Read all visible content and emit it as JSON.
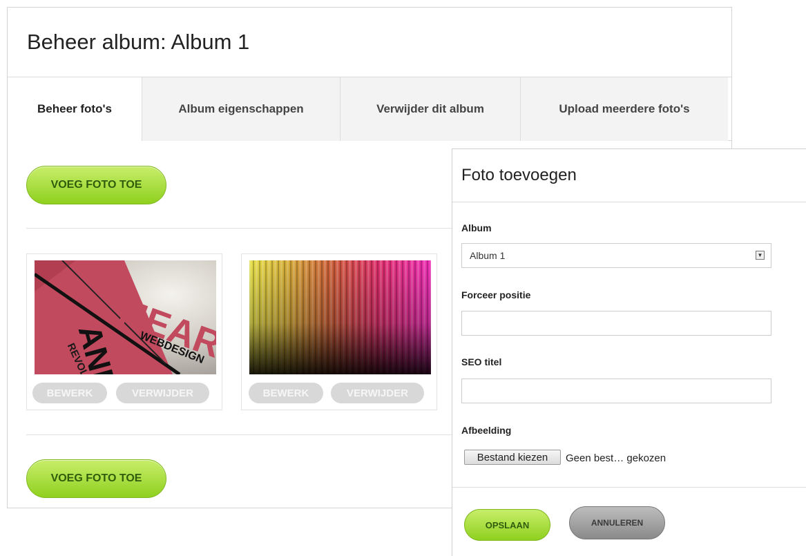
{
  "page": {
    "title": "Beheer album: Album 1"
  },
  "tabs": [
    {
      "label": "Beheer foto's",
      "active": true
    },
    {
      "label": "Album eigenschappen",
      "active": false
    },
    {
      "label": "Verwijder dit album",
      "active": false
    },
    {
      "label": "Upload meerdere foto's",
      "active": false
    }
  ],
  "actions": {
    "add_photo_label": "VOEG FOTO TOE"
  },
  "photos": [
    {
      "edit_label": "BEWERK",
      "delete_label": "VERWIJDER",
      "thumbnail_text": [
        "HEART",
        "AND",
        "WEBDESIGN",
        "REVOLUTION"
      ]
    },
    {
      "edit_label": "BEWERK",
      "delete_label": "VERWIJDER"
    }
  ],
  "dialog": {
    "title": "Foto toevoegen",
    "album_label": "Album",
    "album_value": "Album 1",
    "position_label": "Forceer positie",
    "position_value": "",
    "seo_label": "SEO titel",
    "seo_value": "",
    "image_label": "Afbeelding",
    "file_button": "Bestand kiezen",
    "file_status": "Geen best… gekozen",
    "save_label": "OPSLAAN",
    "cancel_label": "ANNULEREN"
  },
  "colors": {
    "accent_green": "#9ad62a",
    "button_text_green": "#2f5d0c",
    "pill_gray": "#d8d8d8"
  }
}
